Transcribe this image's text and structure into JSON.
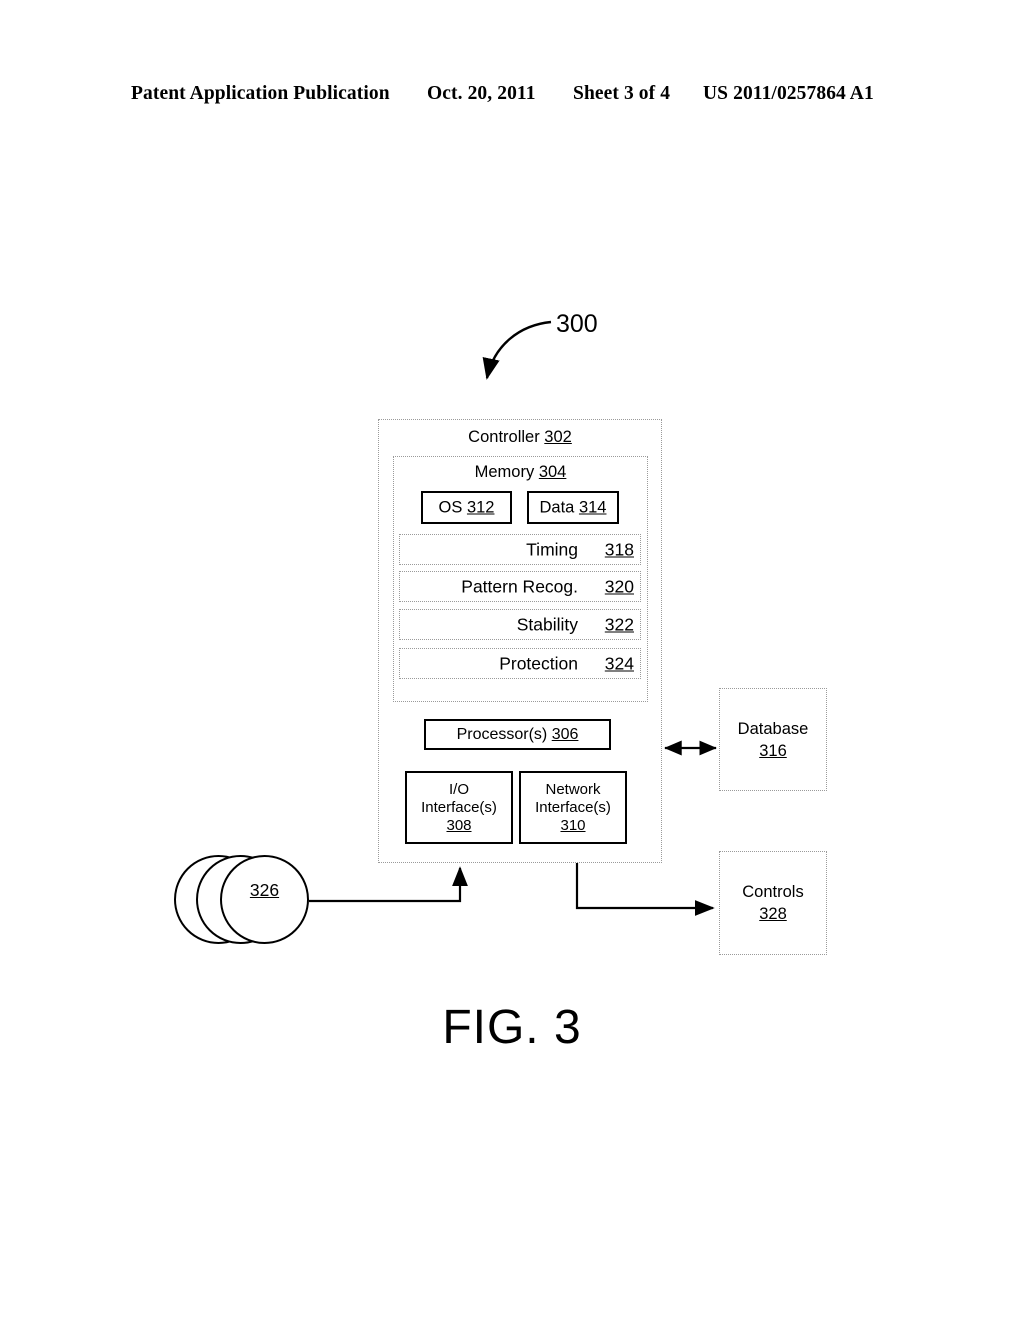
{
  "header": {
    "publication": "Patent Application Publication",
    "date": "Oct. 20, 2011",
    "sheet": "Sheet 3 of 4",
    "number": "US 2011/0257864 A1"
  },
  "figure": {
    "caption": "FIG. 3",
    "system_ref": "300",
    "controller": {
      "title": "Controller 302",
      "label": "Controller",
      "ref": "302",
      "memory": {
        "title": "Memory 304",
        "label": "Memory",
        "ref": "304",
        "os": {
          "label": "OS 312",
          "name": "OS",
          "ref": "312"
        },
        "data": {
          "label": "Data 314",
          "name": "Data",
          "ref": "314"
        },
        "modules": [
          {
            "name": "Timing",
            "ref": "318"
          },
          {
            "name": "Pattern Recog.",
            "ref": "320"
          },
          {
            "name": "Stability",
            "ref": "322"
          },
          {
            "name": "Protection",
            "ref": "324"
          }
        ]
      },
      "processor": {
        "label": "Processor(s) 306",
        "name": "Processor(s)",
        "ref": "306"
      },
      "io_interface": {
        "line1": "I/O",
        "line2": "Interface(s)",
        "ref": "308"
      },
      "network_interface": {
        "line1": "Network",
        "line2": "Interface(s)",
        "ref": "310"
      }
    },
    "database": {
      "name": "Database",
      "ref": "316"
    },
    "controls": {
      "name": "Controls",
      "ref": "328"
    },
    "sensors": {
      "ref": "326"
    }
  },
  "colors": {
    "ink": "#000000",
    "paper": "#ffffff",
    "dotted_border": "#9a9a9a"
  }
}
